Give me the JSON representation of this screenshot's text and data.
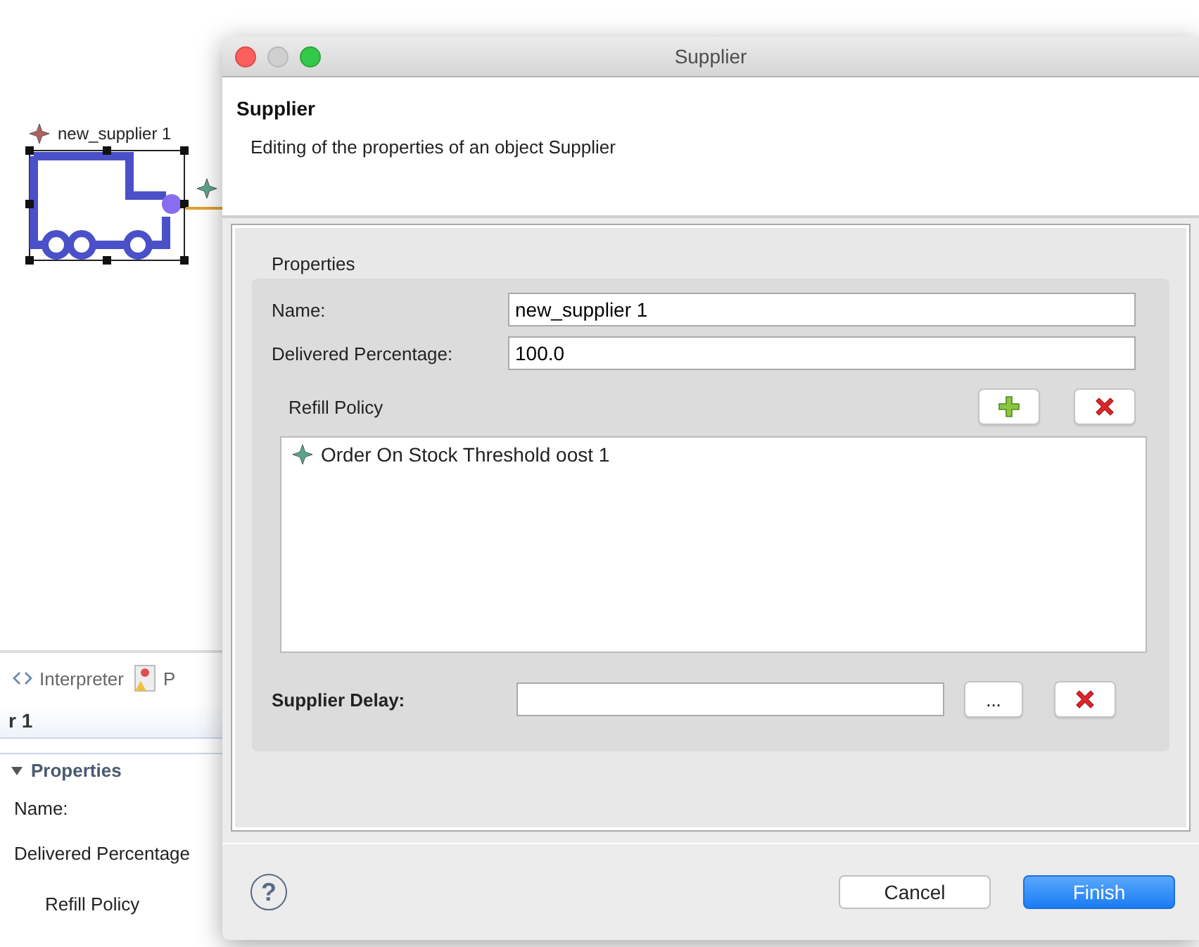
{
  "editor": {
    "node_label": "new_supplier 1",
    "tabs": [
      {
        "label": "Interpreter"
      },
      {
        "label": "P"
      }
    ],
    "title": "r 1",
    "section": {
      "label": "Properties",
      "expanded": true
    },
    "fields": [
      "Name:",
      "Delivered Percentage",
      "Refill Policy"
    ]
  },
  "dialog": {
    "window_title": "Supplier",
    "header_title": "Supplier",
    "header_description": "Editing of the properties of an object Supplier",
    "group_label": "Properties",
    "fields": [
      {
        "label": "Name:",
        "value": "new_supplier 1"
      },
      {
        "label": "Delivered Percentage:",
        "value": "100.0"
      }
    ],
    "refill_policy": {
      "label": "Refill Policy",
      "items": [
        {
          "label": "Order On Stock Threshold oost 1"
        }
      ]
    },
    "supplier_delay": {
      "label": "Supplier Delay:",
      "browse": "..."
    },
    "help": "?",
    "buttons": [
      {
        "label": "Cancel",
        "default": false
      },
      {
        "label": "Finish",
        "default": true
      }
    ]
  }
}
